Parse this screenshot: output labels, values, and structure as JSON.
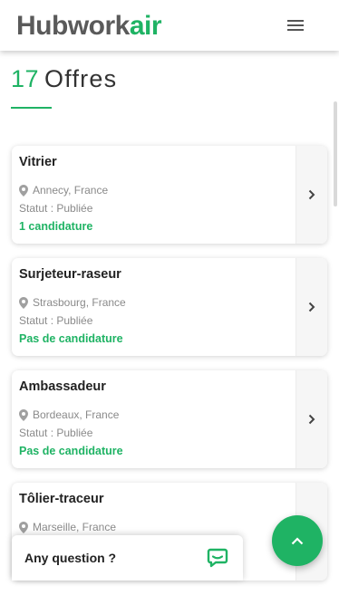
{
  "header": {
    "logo_dark": "Hubwork",
    "logo_green": "air",
    "menu_icon": "hamburger-menu-icon"
  },
  "page": {
    "count": "17",
    "label": "Offres"
  },
  "offers": [
    {
      "title": "Vitrier",
      "location": "Annecy, France",
      "status": "Statut : Publiée",
      "applications": "1 candidature"
    },
    {
      "title": "Surjeteur-raseur",
      "location": "Strasbourg, France",
      "status": "Statut : Publiée",
      "applications": "Pas de candidature"
    },
    {
      "title": "Ambassadeur",
      "location": "Bordeaux, France",
      "status": "Statut : Publiée",
      "applications": "Pas de candidature"
    },
    {
      "title": "Tôlier-traceur",
      "location": "Marseille, France",
      "status": "",
      "applications": ""
    }
  ],
  "chat": {
    "label": "Any question ?",
    "icon": "chat-bubble-icon"
  },
  "scroll_top": {
    "icon": "chevron-up-icon"
  },
  "colors": {
    "accent": "#1fb364",
    "text": "#222222",
    "muted": "#8a8a8a",
    "logo_dark": "#5a5a5a"
  }
}
